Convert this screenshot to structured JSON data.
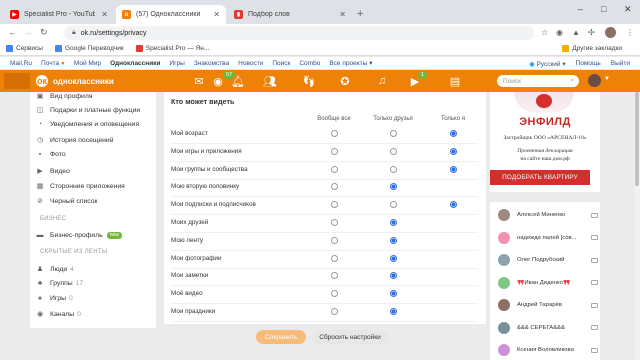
{
  "browser": {
    "tabs": [
      {
        "title": "Specialist Pro - YouTube",
        "fav_color": "#ff0000"
      },
      {
        "title": "(57) Одноклассники",
        "fav_color": "#ee8208"
      },
      {
        "title": "Подбор слов",
        "fav_color": "#e53935"
      }
    ],
    "window_controls": [
      "–",
      "□",
      "✕"
    ],
    "new_tab_label": "+",
    "url": "ok.ru/settings/privacy",
    "bookmarks": [
      {
        "label": "Сервисы",
        "color": "#4285f4"
      },
      {
        "label": "Google Переводчик",
        "color": "#4285f4"
      },
      {
        "label": "Specialist Pro — Ян...",
        "color": "#e53935"
      }
    ],
    "other_bookmarks": "Другие закладки"
  },
  "portal": {
    "links": [
      "Mail.Ru",
      "Почта",
      "Мой Мир",
      "Одноклассники",
      "Игры",
      "Знакомства",
      "Новости",
      "Поиск",
      "Combo",
      "Все проекты"
    ],
    "mail_badge": "●",
    "bold_index": 3,
    "lang": "Русский",
    "help": "Помощь",
    "exit": "Выйти"
  },
  "header": {
    "logo_letter": "ок",
    "site_name": "одноклассники",
    "badges": {
      "discussions": "57",
      "games": "1"
    },
    "search_placeholder": "Поиск"
  },
  "left_menu": {
    "top_items": [
      {
        "label": "Вид профиля",
        "icon": "profile-view-icon",
        "glyph": "▣"
      },
      {
        "label": "Подарки и платные функции",
        "icon": "gift-icon",
        "glyph": "◫"
      },
      {
        "label": "Уведомления и оповещения",
        "icon": "bell-icon",
        "glyph": "◔"
      },
      {
        "label": "История посещений",
        "icon": "history-icon",
        "glyph": "◷"
      },
      {
        "label": "Фото",
        "icon": "photo-icon",
        "glyph": "▪"
      },
      {
        "label": "Видео",
        "icon": "video-icon",
        "glyph": "▶"
      },
      {
        "label": "Сторонние приложения",
        "icon": "apps-icon",
        "glyph": "▦"
      },
      {
        "label": "Черный список",
        "icon": "blacklist-icon",
        "glyph": "⊘"
      }
    ],
    "business_header": "БИЗНЕС",
    "business_item": {
      "label": "Бизнес-профиль",
      "badge": "new"
    },
    "hidden_header": "СКРЫТЫЕ ИЗ ЛЕНТЫ",
    "hidden_items": [
      {
        "label": "Люди",
        "count": "4",
        "icon": "people-icon",
        "glyph": "♟"
      },
      {
        "label": "Группы",
        "count": "17",
        "icon": "groups-icon",
        "glyph": "♣"
      },
      {
        "label": "Игры",
        "count": "0",
        "icon": "games-icon",
        "glyph": "♠"
      },
      {
        "label": "Каналы",
        "count": "0",
        "icon": "channels-icon",
        "glyph": "◉"
      }
    ]
  },
  "privacy": {
    "title": "Кто может видеть",
    "columns": [
      "Вообще все",
      "Только друзья",
      "Только я"
    ],
    "rows": [
      {
        "label": "Мой возраст",
        "options": 3,
        "selected": 2
      },
      {
        "label": "Мои игры и приложения",
        "options": 3,
        "selected": 2
      },
      {
        "label": "Мои группы и сообщества",
        "options": 3,
        "selected": 2
      },
      {
        "label": "Мою вторую половинку",
        "options": 2,
        "selected": 1
      },
      {
        "label": "Мои подписки и подписчиков",
        "options": 3,
        "selected": 2
      },
      {
        "label": "Моих друзей",
        "options": 2,
        "selected": 1
      },
      {
        "label": "Мою ленту",
        "options": 2,
        "selected": 1
      },
      {
        "label": "Мои фотографии",
        "options": 2,
        "selected": 1
      },
      {
        "label": "Мои заметки",
        "options": 2,
        "selected": 1
      },
      {
        "label": "Моё видео",
        "options": 2,
        "selected": 1
      },
      {
        "label": "Мои праздники",
        "options": 2,
        "selected": 1
      }
    ],
    "save_label": "Сохранить",
    "reset_label": "Сбросить настройки"
  },
  "ad": {
    "brand": "ЭНФИЛД",
    "developer": "Застройщик ООО «АРСЕНАЛ-10»",
    "declaration_line1": "Проектная декларация",
    "declaration_line2": "на сайте наш.дом.рф",
    "cta": "ПОДОБРАТЬ КВАРТИРУ"
  },
  "friends": [
    {
      "name": "Алексей Миненко",
      "color": "#a1887f"
    },
    {
      "name": "надежда палей [сов...",
      "color": "#f48fb1"
    },
    {
      "name": "Олег Подрубский",
      "color": "#90a4ae"
    },
    {
      "name": "🎀Иван Диденко🎀",
      "color": "#81c784"
    },
    {
      "name": "Андрей Тарарёв",
      "color": "#8d6e63"
    },
    {
      "name": "&&& СЕРЕГА&&&",
      "color": "#78909c"
    },
    {
      "name": "Ксения Воловликова",
      "color": "#ce93d8"
    }
  ],
  "colors": {
    "ok_orange": "#ee8208",
    "radio_on": "#2e6fe0",
    "cta_red": "#d32f2f"
  }
}
